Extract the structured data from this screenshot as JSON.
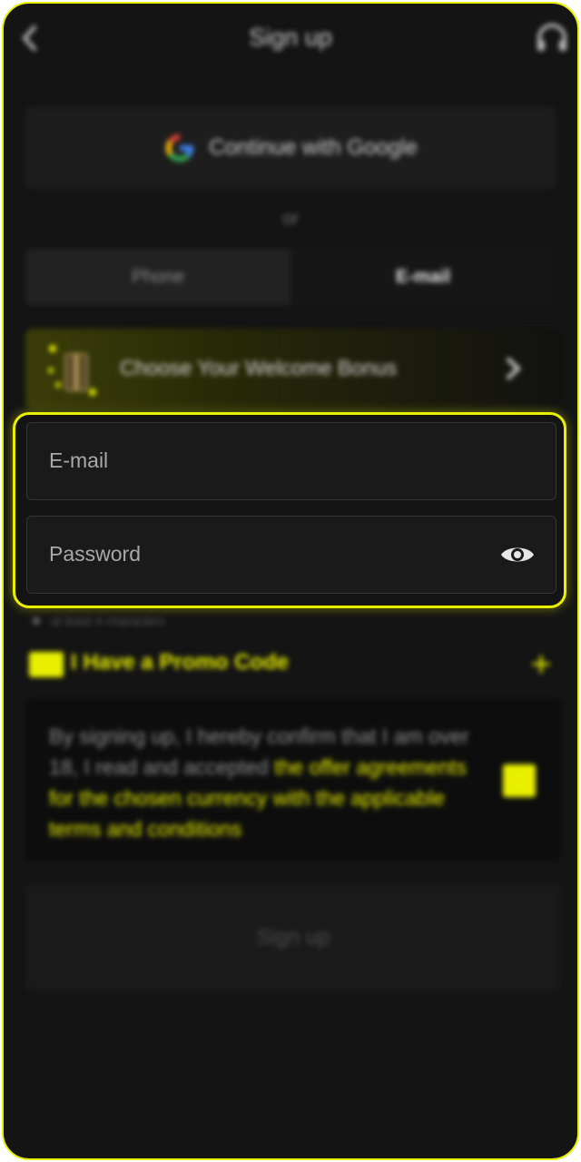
{
  "header": {
    "title": "Sign up"
  },
  "google": {
    "label": "Continue with Google"
  },
  "divider": {
    "text": "or"
  },
  "tabs": [
    {
      "label": "Phone",
      "active": false
    },
    {
      "label": "E-mail",
      "active": true
    }
  ],
  "bonus": {
    "label": "Choose Your Welcome Bonus"
  },
  "form": {
    "email_placeholder": "E-mail",
    "password_placeholder": "Password"
  },
  "password_hint": "at least 4 characters",
  "promo": {
    "label": "I Have a Promo Code"
  },
  "terms": {
    "prefix": "By signing up, I hereby confirm that I am over 18, I read and accepted ",
    "link": "the offer agreements for the chosen currency with the applicable terms and conditions",
    "checked": true
  },
  "signup_button": {
    "label": "Sign up"
  },
  "colors": {
    "accent": "#e8f000",
    "background": "#141414"
  }
}
